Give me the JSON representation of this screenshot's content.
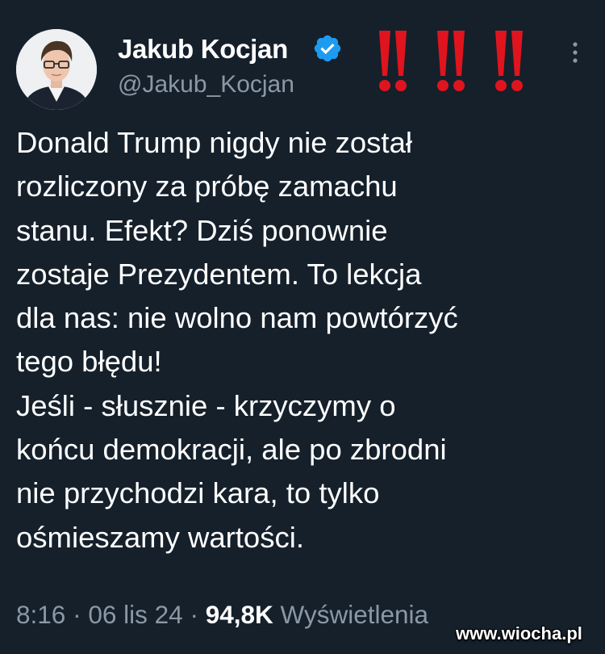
{
  "tweet": {
    "author_name": "Jakub Kocjan",
    "handle": "@Jakub_Kocjan",
    "verified_icon": "verified-badge-icon",
    "marks_icon": "double-exclamation-icon",
    "more_icon": "more-vertical-icon",
    "text": "Donald Trump nigdy nie został\nrozliczony za próbę zamachu\nstanu. Efekt? Dziś ponownie\nzostaje Prezydentem. To lekcja\ndla nas: nie wolno nam powtórzyć\ntego błędu!\nJeśli - słusznie - krzyczymy o\nkońcu demokracji, ale po zbrodni\nnie przychodzi kara, to tylko\nośmieszamy wartości.",
    "time": "8:16",
    "date": "06 lis 24",
    "separator": "·",
    "views_count": "94,8K",
    "views_label": "Wyświetlenia"
  },
  "watermark": {
    "text": "www.wiocha.pl"
  },
  "colors": {
    "background": "#15202b",
    "text": "#ffffff",
    "secondary": "#8b98a5",
    "verified": "#1d9bf0",
    "exclamation": "#e0141e"
  }
}
